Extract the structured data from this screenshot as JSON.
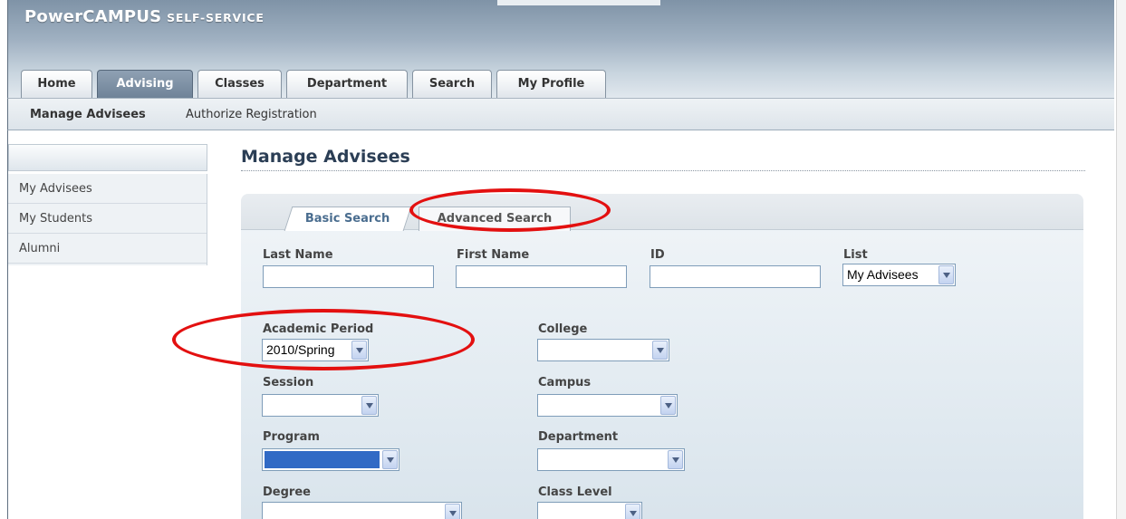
{
  "app": {
    "logo_bold": "PowerCAMPUS",
    "logo_small": "SELF-SERVICE"
  },
  "tabs": [
    {
      "label": "Home"
    },
    {
      "label": "Advising"
    },
    {
      "label": "Classes"
    },
    {
      "label": "Department"
    },
    {
      "label": "Search"
    },
    {
      "label": "My Profile"
    }
  ],
  "subnav": [
    {
      "label": "Manage Advisees"
    },
    {
      "label": "Authorize Registration"
    }
  ],
  "sidebar": {
    "items": [
      {
        "label": "My Advisees"
      },
      {
        "label": "My Students"
      },
      {
        "label": "Alumni"
      }
    ]
  },
  "main": {
    "title": "Manage Advisees",
    "search_tabs": [
      {
        "label": "Basic Search"
      },
      {
        "label": "Advanced Search"
      }
    ],
    "fields": {
      "last_name": {
        "label": "Last Name",
        "value": ""
      },
      "first_name": {
        "label": "First Name",
        "value": ""
      },
      "id": {
        "label": "ID",
        "value": ""
      },
      "list": {
        "label": "List",
        "value": "My Advisees"
      },
      "academic_period": {
        "label": "Academic Period",
        "value": "2010/Spring"
      },
      "college": {
        "label": "College",
        "value": ""
      },
      "session": {
        "label": "Session",
        "value": ""
      },
      "campus": {
        "label": "Campus",
        "value": ""
      },
      "program": {
        "label": "Program",
        "value": ""
      },
      "department": {
        "label": "Department",
        "value": ""
      },
      "degree": {
        "label": "Degree",
        "value": ""
      },
      "class_level": {
        "label": "Class Level",
        "value": ""
      }
    }
  },
  "colors": {
    "annotation_ring": "#e31010",
    "selection_highlight": "#316ac5",
    "title_text": "#2b3e55"
  }
}
